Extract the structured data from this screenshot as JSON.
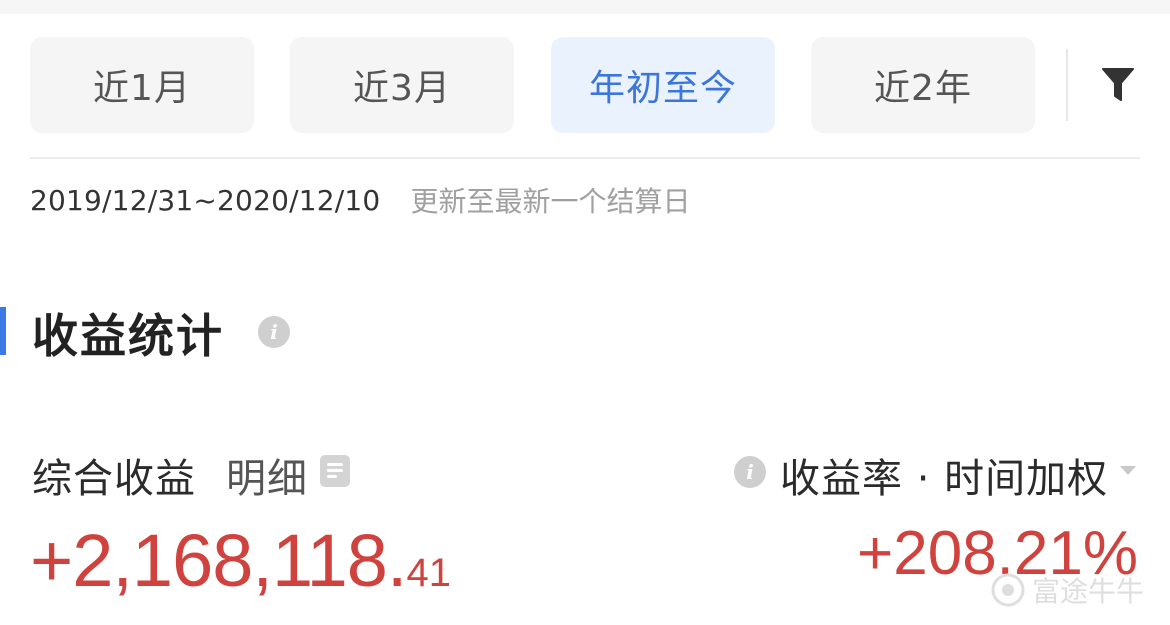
{
  "tabs": [
    {
      "label": "近1月",
      "active": false
    },
    {
      "label": "近3月",
      "active": false
    },
    {
      "label": "年初至今",
      "active": true
    },
    {
      "label": "近2年",
      "active": false
    }
  ],
  "filter_icon": "filter-icon",
  "range": {
    "dates": "2019/12/31~2020/12/10",
    "note": "更新至最新一个结算日"
  },
  "section": {
    "title": "收益统计",
    "info_icon": "info-icon"
  },
  "summary": {
    "combined_label": "综合收益",
    "detail_label": "明细",
    "detail_icon": "document-icon",
    "rate_mode_label": "收益率 · 时间加权",
    "amount_main": "+2,168,118.",
    "amount_decimal": "41",
    "rate_value": "+208.21%"
  },
  "watermark": {
    "text": "富途牛牛",
    "logo_icon": "futu-logo-icon"
  },
  "colors": {
    "accent_blue": "#3c76d8",
    "active_tab_bg": "#eaf2fd",
    "profit_red": "#d0423e",
    "muted_gray": "#a0a0a0"
  }
}
